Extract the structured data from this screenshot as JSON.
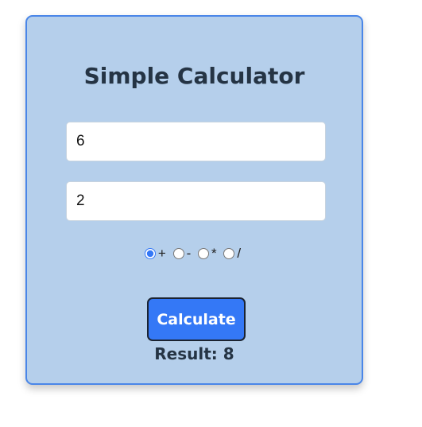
{
  "calculator": {
    "title": "Simple Calculator",
    "first_number": "6",
    "second_number": "2",
    "operations": [
      {
        "symbol": "+",
        "selected": true
      },
      {
        "symbol": "-",
        "selected": false
      },
      {
        "symbol": "*",
        "selected": false
      },
      {
        "symbol": "/",
        "selected": false
      }
    ],
    "calculate_label": "Calculate",
    "result_label": "Result:",
    "result_value": "8"
  },
  "colors": {
    "card_background": "#b5cfeb",
    "card_border": "#4a86e8",
    "button_background": "#3478f6",
    "text_dark": "#253444"
  }
}
